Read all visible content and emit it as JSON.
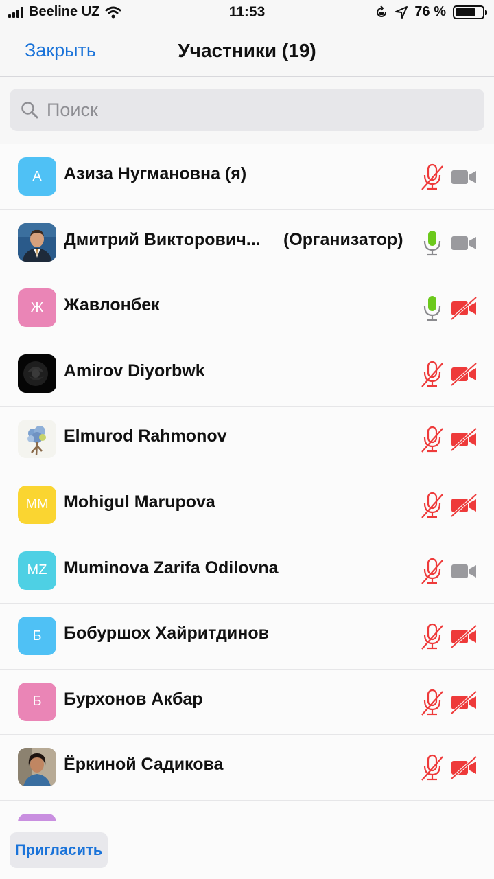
{
  "status_bar": {
    "carrier": "Beeline UZ",
    "time": "11:53",
    "battery_percent_label": "76 %",
    "battery_level": 0.76
  },
  "nav": {
    "close_label": "Закрыть",
    "title": "Участники (19)"
  },
  "search": {
    "placeholder": "Поиск",
    "value": ""
  },
  "participants": [
    {
      "name": "Азиза Нугмановна (я)",
      "role": "",
      "initials": "А",
      "avatar_color": "#4fc1f5",
      "avatar_type": "initials",
      "mic": "muted",
      "video": "on"
    },
    {
      "name": "Дмитрий Викторович...",
      "role": "(Организатор)",
      "initials": "",
      "avatar_color": "#23476b",
      "avatar_type": "photo-man-suit",
      "mic": "on",
      "video": "on"
    },
    {
      "name": "Жавлонбек",
      "role": "",
      "initials": "Ж",
      "avatar_color": "#ea85b6",
      "avatar_type": "initials",
      "mic": "on",
      "video": "off"
    },
    {
      "name": "Amirov Diyorbwk",
      "role": "",
      "initials": "",
      "avatar_color": "#111111",
      "avatar_type": "photo-black-rose",
      "mic": "muted",
      "video": "off"
    },
    {
      "name": "Elmurod Rahmonov",
      "role": "",
      "initials": "",
      "avatar_color": "#f2f2ee",
      "avatar_type": "photo-flower-tree",
      "mic": "muted",
      "video": "off"
    },
    {
      "name": "Mohigul Marupova",
      "role": "",
      "initials": "MM",
      "avatar_color": "#fad531",
      "avatar_type": "initials",
      "mic": "muted",
      "video": "off"
    },
    {
      "name": "Muminova Zarifa Odilovna",
      "role": "",
      "initials": "MZ",
      "avatar_color": "#4ed0e4",
      "avatar_type": "initials",
      "mic": "muted",
      "video": "on"
    },
    {
      "name": "Бобуршох Хайритдинов",
      "role": "",
      "initials": "Б",
      "avatar_color": "#4fc1f5",
      "avatar_type": "initials",
      "mic": "muted",
      "video": "off"
    },
    {
      "name": "Бурхонов Акбар",
      "role": "",
      "initials": "Б",
      "avatar_color": "#ea85b6",
      "avatar_type": "initials",
      "mic": "muted",
      "video": "off"
    },
    {
      "name": "Ёркиной Садикова",
      "role": "",
      "initials": "",
      "avatar_color": "#a89a86",
      "avatar_type": "photo-woman",
      "mic": "muted",
      "video": "off"
    },
    {
      "name": "",
      "role": "",
      "initials": "",
      "avatar_color": "#c98fe0",
      "avatar_type": "initials",
      "mic": "none",
      "video": "none"
    }
  ],
  "colors": {
    "accent": "#1a73d9",
    "muted_red": "#ee3a3a",
    "mic_on_green": "#6cc91c",
    "camera_on_gray": "#9a9a9e"
  },
  "icons": {
    "search": "magnifier-icon",
    "mic_muted": "mic-muted-icon",
    "mic_on": "mic-on-icon",
    "video_on": "video-camera-icon",
    "video_off": "video-camera-off-icon"
  },
  "bottom": {
    "invite_label": "Пригласить"
  }
}
